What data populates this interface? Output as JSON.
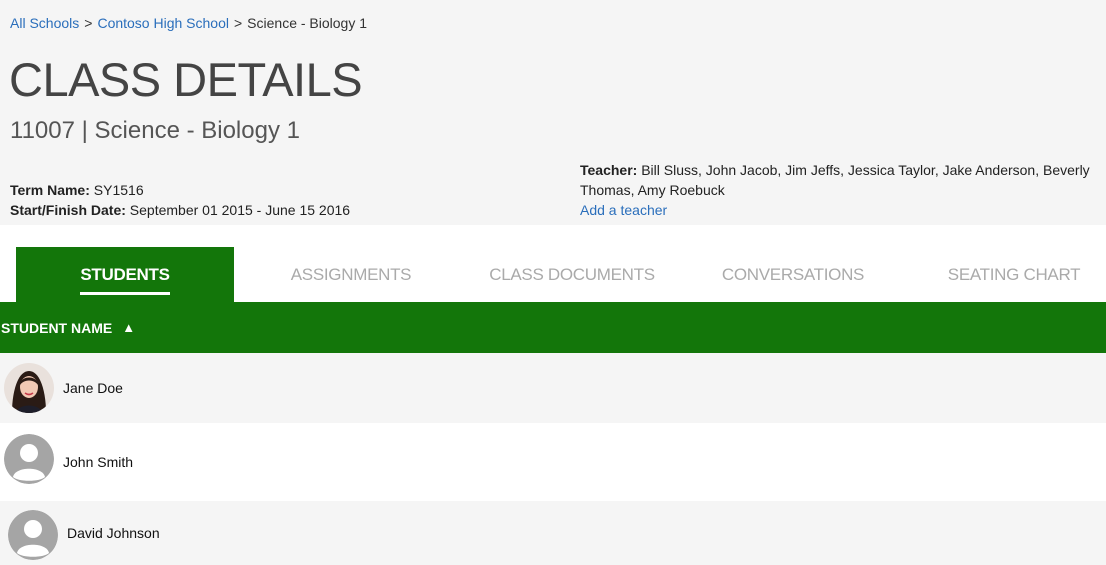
{
  "breadcrumb": {
    "items": [
      "All Schools",
      "Contoso High School"
    ],
    "separator": ">",
    "current": "Science - Biology 1"
  },
  "header": {
    "title": "CLASS DETAILS",
    "subtitle": "11007 | Science - Biology 1"
  },
  "meta": {
    "term_label": "Term Name:",
    "term_value": "SY1516",
    "date_label": "Start/Finish Date:",
    "date_value": "September 01 2015 - June 15 2016",
    "teacher_label": "Teacher:",
    "teacher_value": "Bill Sluss, John Jacob, Jim Jeffs, Jessica Taylor, Jake Anderson, Beverly Thomas, Amy Roebuck",
    "add_teacher": "Add a teacher"
  },
  "tabs": [
    {
      "label": "STUDENTS",
      "active": true
    },
    {
      "label": "ASSIGNMENTS",
      "active": false
    },
    {
      "label": "CLASS DOCUMENTS",
      "active": false
    },
    {
      "label": "CONVERSATIONS",
      "active": false
    },
    {
      "label": "SEATING CHART",
      "active": false
    }
  ],
  "table": {
    "column_header": "STUDENT NAME",
    "sort_indicator": "▲",
    "rows": [
      {
        "name": "Jane Doe",
        "avatar": "photo-avatar"
      },
      {
        "name": "John Smith",
        "avatar": "default-avatar-icon"
      },
      {
        "name": "David Johnson",
        "avatar": "default-avatar-icon"
      }
    ]
  },
  "colors": {
    "accent_green": "#13760a",
    "link_blue": "#2a6ebb",
    "inactive_tab": "#aaaaaa"
  }
}
